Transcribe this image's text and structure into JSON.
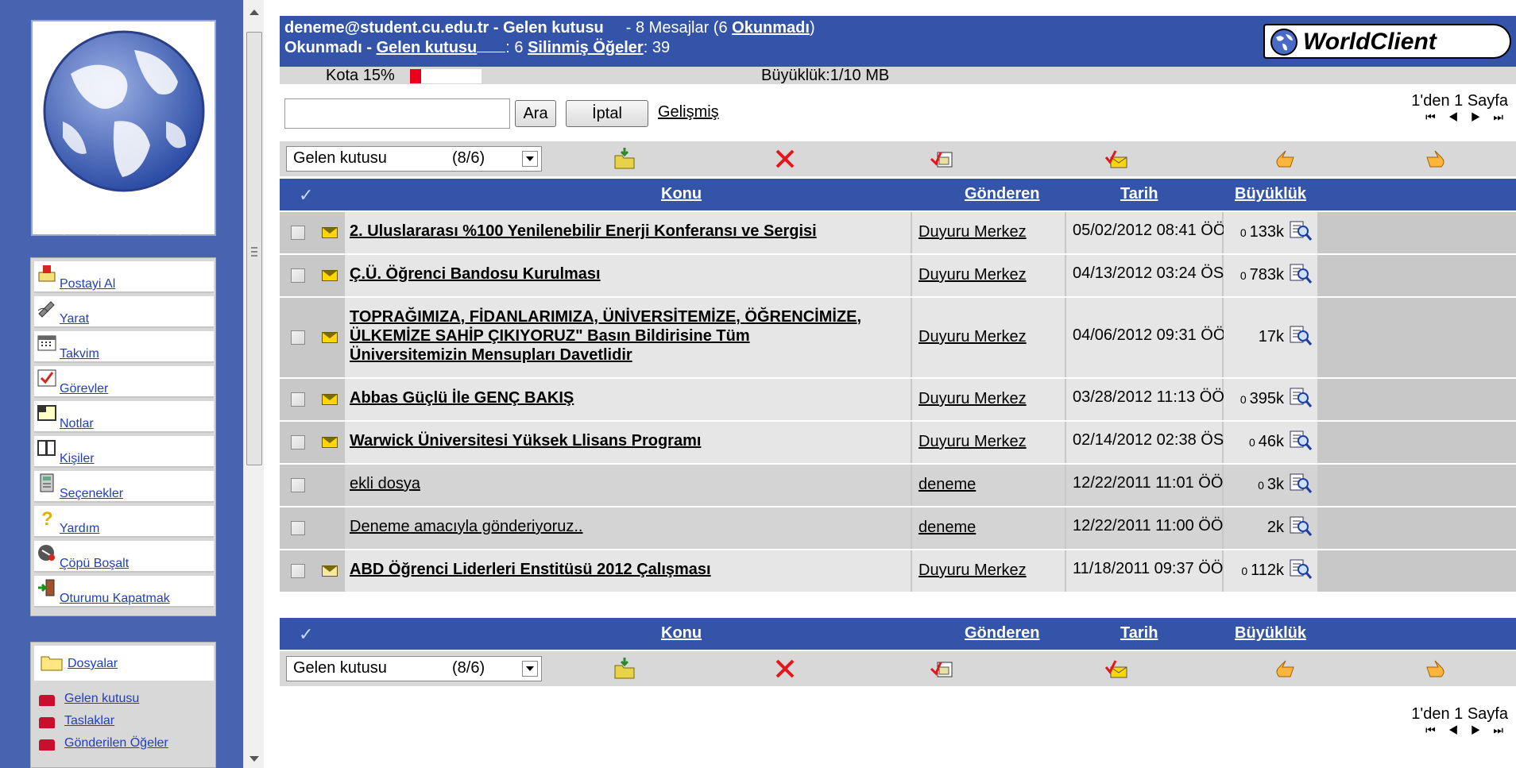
{
  "sidebar": {
    "logo_text": "WorldClient",
    "nav": [
      {
        "label": "Postayi Al",
        "icon": "get-mail-icon"
      },
      {
        "label": "Yarat",
        "icon": "compose-icon"
      },
      {
        "label": "Takvim",
        "icon": "calendar-icon"
      },
      {
        "label": "Görevler",
        "icon": "tasks-icon"
      },
      {
        "label": "Notlar",
        "icon": "notes-icon"
      },
      {
        "label": "Kişiler",
        "icon": "contacts-icon"
      },
      {
        "label": "Seçenekler",
        "icon": "options-icon"
      },
      {
        "label": "Yardım",
        "icon": "help-icon"
      },
      {
        "label": "Çöpü Boşalt",
        "icon": "empty-trash-icon"
      },
      {
        "label": "Oturumu Kapatmak",
        "icon": "logout-icon"
      }
    ],
    "folders_label": "Dosyalar",
    "folders": [
      "Gelen kutusu",
      "Taslaklar",
      "Gönderilen Öğeler"
    ]
  },
  "header": {
    "account": "deneme@student.cu.edu.tr - Gelen kutusu",
    "count_text": "- 8 Mesajlar (6",
    "unread_link": "Okunmadı",
    "count_close": ")",
    "unread_prefix": "Okunmadı -",
    "inbox_link": "Gelen kutusu",
    "inbox_count": ": 6",
    "deleted_link": "Silinmiş Öğeler",
    "deleted_count": ": 39",
    "brand": "WorldClient"
  },
  "quota": {
    "label": "Kota 15%",
    "percent": 15,
    "size": "Büyüklük:1/10 MB"
  },
  "search": {
    "value": "",
    "search_button": "Ara",
    "cancel_button": "İptal",
    "advanced": "Gelişmiş"
  },
  "pager": {
    "text": "1'den 1 Sayfa",
    "arrows": "⏮ ◀ ▶ ⏭"
  },
  "toolbar": {
    "folder_select": "Gelen kutusu",
    "folder_count": "(8/6)"
  },
  "columns": {
    "subject": "Konu",
    "sender": "Gönderen",
    "date": "Tarih",
    "size": "Büyüklük"
  },
  "messages": [
    {
      "subject_lines": [
        "2. Uluslararası %100 Yenilenebilir Enerji Konferansı ve Sergisi"
      ],
      "sender": "Duyuru Merkez",
      "date": "05/02/2012 08:41 ÖÖ",
      "size": "133k",
      "attachment": true,
      "unread": true
    },
    {
      "subject_lines": [
        "Ç.Ü. Öğrenci Bandosu Kurulması"
      ],
      "sender": "Duyuru Merkez",
      "date": "04/13/2012 03:24 ÖS",
      "size": "783k",
      "attachment": true,
      "unread": true
    },
    {
      "subject_lines": [
        "TOPRAĞIMIZA, FİDANLARIMIZA, ÜNİVERSİTEMİZE, ÖĞRENCİMİZE,",
        "ÜLKEMİZE SAHİP ÇIKIYORUZ\" Basın Bildirisine Tüm",
        "Üniversitemizin Mensupları Davetlidir"
      ],
      "sender": "Duyuru Merkez",
      "date": "04/06/2012 09:31 ÖÖ",
      "size": "17k",
      "attachment": false,
      "unread": true
    },
    {
      "subject_lines": [
        "Abbas Güçlü İle GENÇ BAKIŞ"
      ],
      "sender": "Duyuru Merkez",
      "date": "03/28/2012 11:13 ÖÖ",
      "size": "395k",
      "attachment": true,
      "unread": true
    },
    {
      "subject_lines": [
        "Warwick Üniversitesi Yüksek Llisans Programı"
      ],
      "sender": "Duyuru Merkez",
      "date": "02/14/2012 02:38 ÖS",
      "size": "46k",
      "attachment": true,
      "unread": true
    },
    {
      "subject_lines": [
        "ekli dosya"
      ],
      "sender": "deneme",
      "date": "12/22/2011 11:01 ÖÖ",
      "size": "3k",
      "attachment": true,
      "unread": false
    },
    {
      "subject_lines": [
        "Deneme amacıyla gönderiyoruz.."
      ],
      "sender": "deneme",
      "date": "12/22/2011 11:00 ÖÖ",
      "size": "2k",
      "attachment": false,
      "unread": false
    },
    {
      "subject_lines": [
        "ABD Öğrenci Liderleri Enstitüsü 2012 Çalışması"
      ],
      "sender": "Duyuru Merkez",
      "date": "11/18/2011 09:37 ÖÖ",
      "size": "112k",
      "attachment": true,
      "unread": true,
      "opened_icon": true
    }
  ],
  "colors": {
    "sidebar_bg": "#4863b0",
    "header_bg": "#3354a8",
    "quota_fill": "#e8001c",
    "link": "#1f3fc0"
  }
}
